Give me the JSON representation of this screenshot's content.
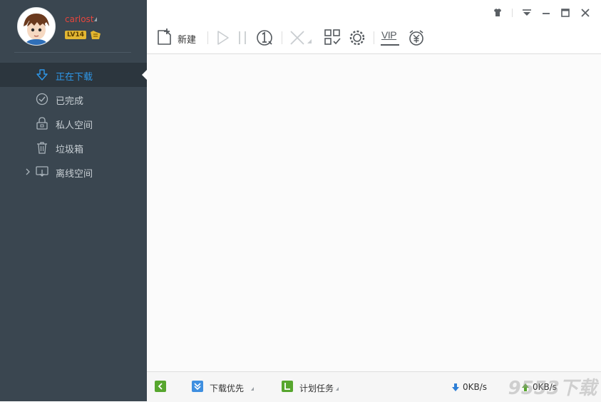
{
  "user": {
    "name": "carlost",
    "level": "LV14"
  },
  "sidebar": {
    "items": [
      {
        "label": "正在下载",
        "icon": "download-arrow-icon",
        "active": true
      },
      {
        "label": "已完成",
        "icon": "check-circle-icon",
        "active": false
      },
      {
        "label": "私人空间",
        "icon": "lock-icon",
        "active": false
      },
      {
        "label": "垃圾箱",
        "icon": "trash-icon",
        "active": false
      },
      {
        "label": "离线空间",
        "icon": "cloud-download-icon",
        "active": false
      }
    ]
  },
  "toolbar": {
    "new_label": "新建",
    "icons": [
      "new-task-icon",
      "play-icon",
      "pause-icon",
      "one-click-icon",
      "delete-icon",
      "qrcode-icon",
      "settings-icon",
      "vip-icon",
      "money-icon"
    ],
    "vip_text": "VIP"
  },
  "window_controls": [
    "skin-icon",
    "menu-icon",
    "minimize-icon",
    "maximize-icon",
    "close-icon"
  ],
  "statusbar": {
    "download_priority": "下载优先",
    "scheduled_tasks": "计划任务",
    "download_speed": "0KB/s",
    "upload_speed": "0KB/s"
  },
  "watermark": "9553下载",
  "colors": {
    "sidebar_bg": "#3a4650",
    "active_item_bg": "#2c363e",
    "active_text": "#2e97e8",
    "username": "#e5453d",
    "level_badge": "#e2b632",
    "status_green": "#57a62e",
    "status_blue": "#3f8fe0"
  }
}
